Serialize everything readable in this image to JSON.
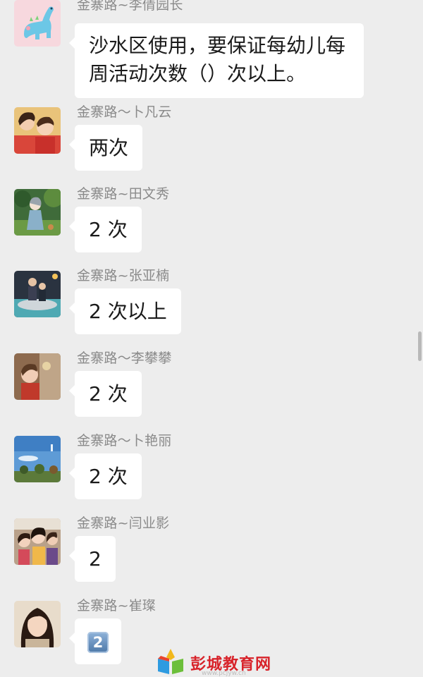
{
  "messages": [
    {
      "sender": "金寨路~李倩园长",
      "text": "沙水区使用，要保证每幼儿每周活动次数（）次以上。",
      "avatar_icon": "blue-dinosaur-avatar"
    },
    {
      "sender": "金寨路～卜凡云",
      "text": "两次",
      "avatar_icon": "mother-child-photo-avatar"
    },
    {
      "sender": "金寨路~田文秀",
      "text": "2 次",
      "avatar_icon": "illustrated-girl-forest-avatar"
    },
    {
      "sender": "金寨路~张亚楠",
      "text": "2 次以上",
      "avatar_icon": "family-photo-avatar"
    },
    {
      "sender": "金寨路～李攀攀",
      "text": "2 次",
      "avatar_icon": "child-photo-avatar"
    },
    {
      "sender": "金寨路～卜艳丽",
      "text": "2 次",
      "avatar_icon": "sky-landscape-avatar"
    },
    {
      "sender": "金寨路~闫业影",
      "text": "2",
      "avatar_icon": "group-selfie-avatar"
    },
    {
      "sender": "金寨路~崔璨",
      "text": "2",
      "avatar_icon": "woman-portrait-avatar",
      "style": "keycap-emoji"
    }
  ],
  "watermark": {
    "name": "彭城教育网",
    "url": "www.pcjyw.cn"
  },
  "colors": {
    "background": "#ededed",
    "bubble": "#ffffff",
    "sender_text": "#8a8a8a",
    "watermark_red": "#d8232a"
  }
}
